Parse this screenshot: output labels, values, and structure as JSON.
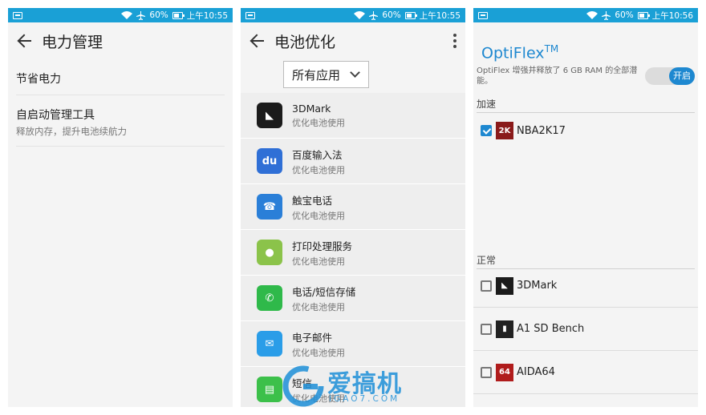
{
  "status": {
    "battery": "60%",
    "times": [
      "上午10:55",
      "上午10:55",
      "上午10:56"
    ],
    "battery_level": 0.6
  },
  "screen1": {
    "title": "电力管理",
    "items": [
      {
        "label": "节省电力",
        "sub": ""
      },
      {
        "label": "自启动管理工具",
        "sub": "释放内存，提升电池续航力"
      }
    ]
  },
  "screen2": {
    "title": "电池优化",
    "filter": "所有应用",
    "apps": [
      {
        "name": "3DMark",
        "sub": "优化电池使用",
        "icon": "3dmark-icon",
        "color": "#1b1b1b",
        "glyph": "◣"
      },
      {
        "name": "百度输入法",
        "sub": "优化电池使用",
        "icon": "baidu-ime-icon",
        "color": "#2f6fd6",
        "glyph": "du"
      },
      {
        "name": "触宝电话",
        "sub": "优化电池使用",
        "icon": "touchpal-icon",
        "color": "#2a7fd8",
        "glyph": "☎"
      },
      {
        "name": "打印处理服务",
        "sub": "优化电池使用",
        "icon": "android-icon",
        "color": "#8bc34a",
        "glyph": "●"
      },
      {
        "name": "电话/短信存储",
        "sub": "优化电池使用",
        "icon": "phone-icon",
        "color": "#2fb94a",
        "glyph": "✆"
      },
      {
        "name": "电子邮件",
        "sub": "优化电池使用",
        "icon": "email-icon",
        "color": "#2a9de8",
        "glyph": "✉"
      },
      {
        "name": "短信",
        "sub": "优化电池使用",
        "icon": "sms-icon",
        "color": "#3cc04a",
        "glyph": "▤"
      }
    ]
  },
  "screen3": {
    "title": "OptiFlex",
    "title_sup": "TM",
    "description": "OptiFlex 增强并释放了 6 GB RAM 的全部潜能。",
    "toggle_label": "开启",
    "toggle_on": true,
    "section_boost": "加速",
    "section_normal": "正常",
    "boost_games": [
      {
        "name": "NBA2K17",
        "checked": true,
        "icon": "nba2k17-icon",
        "color": "#8a1a1a",
        "glyph": "2K"
      }
    ],
    "normal_games": [
      {
        "name": "3DMark",
        "checked": false,
        "icon": "3dmark-icon",
        "color": "#1b1b1b",
        "glyph": "◣"
      },
      {
        "name": "A1 SD Bench",
        "checked": false,
        "icon": "a1sd-icon",
        "color": "#222222",
        "glyph": "▮"
      },
      {
        "name": "AIDA64",
        "checked": false,
        "icon": "aida64-icon",
        "color": "#b01c1c",
        "glyph": "64"
      }
    ]
  },
  "watermark": {
    "main": "爱搞机",
    "sub": "IGAO7.COM"
  },
  "colors": {
    "statusbar": "#1aa0d6",
    "accent": "#1e88d0"
  }
}
